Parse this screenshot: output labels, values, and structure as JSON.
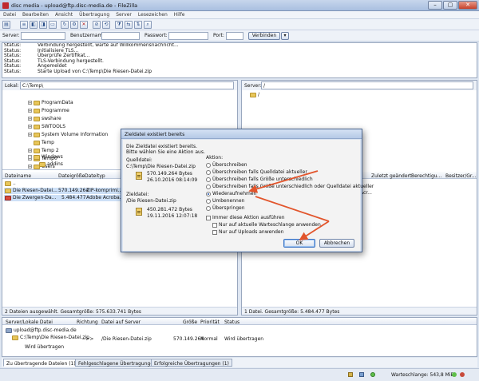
{
  "window": {
    "title": "disc media - upload@ftp.disc-media.de - FileZilla"
  },
  "menu": [
    "Datei",
    "Bearbeiten",
    "Ansicht",
    "Übertragung",
    "Server",
    "Lesezeichen",
    "Hilfe"
  ],
  "connect": {
    "server_label": "Server:",
    "user_label": "Benutzername:",
    "password_label": "Passwort:",
    "port_label": "Port:",
    "connect_button": "Verbinden"
  },
  "log": [
    {
      "k": "Status:",
      "v": "Verbindung hergestellt, warte auf Willkommensnachricht..."
    },
    {
      "k": "Status:",
      "v": "Initialisiere TLS..."
    },
    {
      "k": "Status:",
      "v": "Überprüfe Zertifikat..."
    },
    {
      "k": "Status:",
      "v": "TLS-Verbindung hergestellt."
    },
    {
      "k": "Status:",
      "v": "Angemeldet"
    },
    {
      "k": "Status:",
      "v": "Starte Upload von C:\\Temp\\Die Riesen-Datei.zip"
    }
  ],
  "local": {
    "label": "Lokal:",
    "path": "C:\\Temp\\",
    "tree": [
      "ProgramData",
      "Programme",
      "swshare",
      "SWTOOLS",
      "System Volume Information",
      "Temp",
      "Temp 2",
      "Temp0",
      "Users",
      "Windows",
      "addins"
    ],
    "columns": [
      "Dateiname",
      "Dateigröße",
      "Dateityp"
    ],
    "files": [
      {
        "name": "..",
        "size": "",
        "type": ""
      },
      {
        "name": "Die Riesen-Datei...",
        "size": "570.149.264",
        "type": "ZIP-komprimi..."
      },
      {
        "name": "Die Zwergen-Da...",
        "size": "5.484.477",
        "type": "Adobe Acroba..."
      }
    ],
    "status": "2 Dateien ausgewählt. Gesamtgröße: 575.633.741 Bytes"
  },
  "remote": {
    "label": "Server:",
    "path": "/",
    "root": "/",
    "columns": [
      "Dateiname",
      "Dateigröße",
      "Dateityp",
      "Zuletzt geändert",
      "Berechtigu...",
      "Besitzer/Gr..."
    ],
    "partial": "Acr...",
    "status": "1 Datei. Gesamtgröße: 5.484.477 Bytes"
  },
  "queue": {
    "columns": [
      "Server/Lokale Datei",
      "Richtung",
      "Datei auf Server",
      "Größe",
      "Priorität",
      "Status"
    ],
    "server": "upload@ftp.disc-media.de",
    "row": {
      "local": "C:\\Temp\\Die Riesen-Datei.zip",
      "dir": "-->>",
      "remote": "/Die Riesen-Datei.zip",
      "size": "570.149.264",
      "prio": "Normal",
      "status": "Wird übertragen"
    },
    "sub": "Wird übertragen"
  },
  "tabs": [
    "Zu übertragende Dateien (1)",
    "Fehlgeschlagene Übertragungen",
    "Erfolgreiche Übertragungen (1)"
  ],
  "bottom": {
    "queue_label": "Warteschlange: 543,8 MiB"
  },
  "dialog": {
    "title": "Zieldatei existiert bereits",
    "intro1": "Die Zieldatei existiert bereits.",
    "intro2": "Bitte wählen Sie eine Aktion aus.",
    "source_label": "Quelldatei:",
    "source_path": "C:\\Temp\\Die Riesen-Datei.zip",
    "source_size": "570.149.264 Bytes",
    "source_date": "26.10.2016 08:14:09",
    "target_label": "Zieldatei:",
    "target_path": "/Die Riesen-Datei.zip",
    "target_size": "450.281.472 Bytes",
    "target_date": "19.11.2016 12:07:18",
    "action_label": "Aktion:",
    "options": [
      "Überschreiben",
      "Überschreiben falls Quelldatei aktueller",
      "Überschreiben falls Größe unterschiedlich",
      "Überschreiben falls Größe unterschiedlich oder Quelldatei aktueller",
      "Wiederaufnehmen",
      "Umbenennen",
      "Überspringen"
    ],
    "selected": "Wiederaufnehmen",
    "checks": [
      "Immer diese Aktion ausführen",
      "Nur auf aktuelle Warteschlange anwenden",
      "Nur auf Uploads anwenden"
    ],
    "ok": "OK",
    "cancel": "Abbrechen"
  },
  "colors": {
    "arrow": "#e2552c",
    "accent": "#1b4ea8"
  }
}
